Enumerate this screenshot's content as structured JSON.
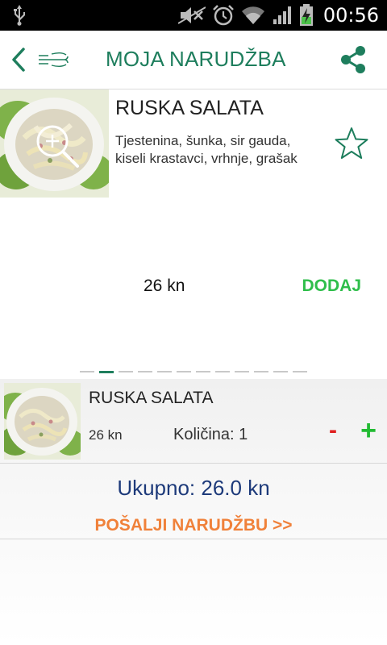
{
  "status_bar": {
    "time": "00:56",
    "icons": [
      "usb-icon",
      "mute-icon",
      "alarm-icon",
      "wifi-icon",
      "signal-icon",
      "battery-charging-icon"
    ]
  },
  "action_bar": {
    "title": "MOJA NARUDŽBA",
    "icons": [
      "back-icon",
      "cutlery-logo-icon",
      "share-icon"
    ],
    "accent_color": "#1e7e5d"
  },
  "product": {
    "name": "RUSKA SALATA",
    "description": "Tjestenina, šunka, sir gauda, kiseli krastavci, vrhnje, grašak",
    "price": "26 kn",
    "add_label": "DODAJ",
    "favorite_icon": "star-outline-icon",
    "zoom_icon": "zoom-in-icon"
  },
  "pager": {
    "page_count": 12,
    "active_index": 1
  },
  "order": {
    "items": [
      {
        "name": "RUSKA SALATA",
        "price": "26 kn",
        "quantity": "Količina: 1",
        "minus": "-",
        "plus": "+"
      }
    ],
    "total": "Ukupno: 26.0 kn",
    "send_label": "POŠALJI NARUDŽBU >>"
  },
  "colors": {
    "add": "#2fbe4b",
    "total": "#1d3a7a",
    "send": "#f0813a",
    "minus": "#e02020",
    "plus": "#22bb33"
  }
}
